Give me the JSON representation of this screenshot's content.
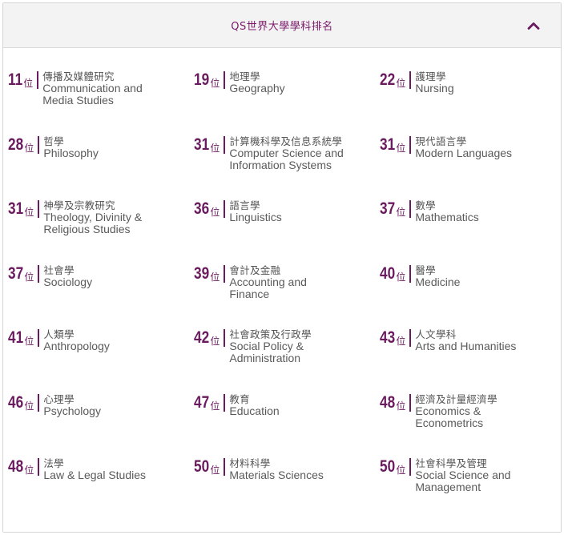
{
  "header": {
    "title": "QS世界大學學科排名"
  },
  "rank_unit": "位",
  "subjects": [
    {
      "rank": "11",
      "zh": "傳播及媒體研究",
      "en": "Communication and Media Studies"
    },
    {
      "rank": "19",
      "zh": "地理學",
      "en": "Geography"
    },
    {
      "rank": "22",
      "zh": "護理學",
      "en": "Nursing"
    },
    {
      "rank": "28",
      "zh": "哲學",
      "en": "Philosophy"
    },
    {
      "rank": "31",
      "zh": "計算機科學及信息系統學",
      "en": "Computer Science and Information Systems"
    },
    {
      "rank": "31",
      "zh": "現代語言學",
      "en": "Modern Languages"
    },
    {
      "rank": "31",
      "zh": "神學及宗教研究",
      "en": "Theology, Divinity & Religious Studies"
    },
    {
      "rank": "36",
      "zh": "語言學",
      "en": "Linguistics"
    },
    {
      "rank": "37",
      "zh": "數學",
      "en": "Mathematics"
    },
    {
      "rank": "37",
      "zh": "社會學",
      "en": "Sociology"
    },
    {
      "rank": "39",
      "zh": "會計及金融",
      "en": "Accounting and Finance"
    },
    {
      "rank": "40",
      "zh": "醫學",
      "en": "Medicine"
    },
    {
      "rank": "41",
      "zh": "人類學",
      "en": "Anthropology"
    },
    {
      "rank": "42",
      "zh": "社會政策及行政學",
      "en": "Social Policy & Administration"
    },
    {
      "rank": "43",
      "zh": "人文學科",
      "en": "Arts and Humanities"
    },
    {
      "rank": "46",
      "zh": "心理學",
      "en": "Psychology"
    },
    {
      "rank": "47",
      "zh": "教育",
      "en": "Education"
    },
    {
      "rank": "48",
      "zh": "經濟及計量經濟學",
      "en": "Economics & Econometrics"
    },
    {
      "rank": "48",
      "zh": "法學",
      "en": "Law & Legal Studies"
    },
    {
      "rank": "50",
      "zh": "材料科學",
      "en": "Materials Sciences"
    },
    {
      "rank": "50",
      "zh": "社會科學及管理",
      "en": "Social Science and Management"
    }
  ]
}
